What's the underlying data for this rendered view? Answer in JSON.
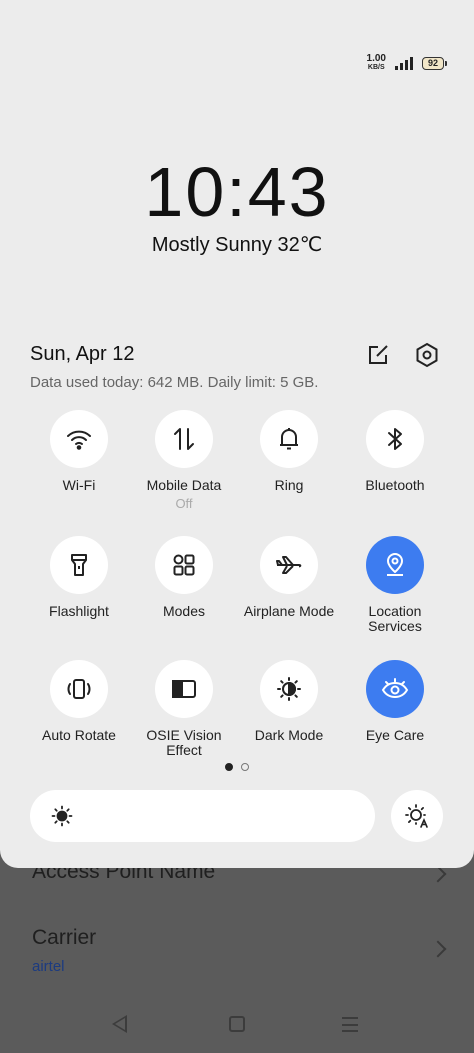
{
  "status_bar": {
    "net_speed_value": "1.00",
    "net_speed_unit": "KB/S",
    "battery_level": "92"
  },
  "clock": {
    "time": "10:43"
  },
  "weather": {
    "text": "Mostly Sunny 32℃"
  },
  "header": {
    "date": "Sun, Apr 12",
    "data_usage": "Data used today: 642 MB. Daily limit: 5 GB."
  },
  "tiles": [
    {
      "label": "Wi-Fi",
      "sub": "",
      "icon": "wifi-icon",
      "on": false
    },
    {
      "label": "Mobile Data",
      "sub": "Off",
      "icon": "mobile-data-icon",
      "on": false
    },
    {
      "label": "Ring",
      "sub": "",
      "icon": "bell-icon",
      "on": false
    },
    {
      "label": "Bluetooth",
      "sub": "",
      "icon": "bluetooth-icon",
      "on": false
    },
    {
      "label": "Flashlight",
      "sub": "",
      "icon": "flashlight-icon",
      "on": false
    },
    {
      "label": "Modes",
      "sub": "",
      "icon": "modes-icon",
      "on": false
    },
    {
      "label": "Airplane Mode",
      "sub": "",
      "icon": "airplane-icon",
      "on": false
    },
    {
      "label": "Location Services",
      "sub": "",
      "icon": "location-icon",
      "on": true
    },
    {
      "label": "Auto Rotate",
      "sub": "",
      "icon": "auto-rotate-icon",
      "on": false
    },
    {
      "label": "OSIE Vision Effect",
      "sub": "",
      "icon": "vision-effect-icon",
      "on": false
    },
    {
      "label": "Dark Mode",
      "sub": "",
      "icon": "dark-mode-icon",
      "on": false
    },
    {
      "label": "Eye Care",
      "sub": "",
      "icon": "eye-icon",
      "on": true
    }
  ],
  "pager": {
    "pages": 2,
    "active": 0
  },
  "background": {
    "row1_title": "Access Point Name",
    "row2_title": "Carrier",
    "row2_sub": "airtel"
  },
  "colors": {
    "accent": "#3d7cf0",
    "shade_bg": "#ececec",
    "dim_bg": "#5b5b5b"
  }
}
